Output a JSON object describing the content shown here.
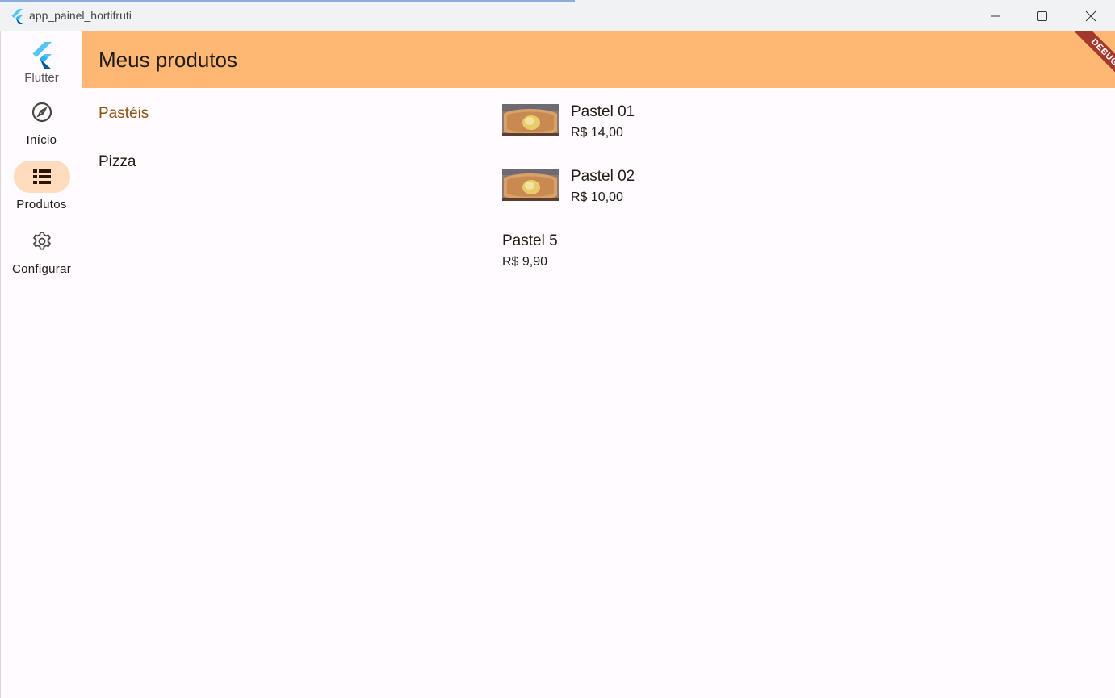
{
  "window": {
    "title": "app_painel_hortifruti"
  },
  "rail": {
    "logo_label": "Flutter",
    "items": [
      {
        "label": "Início",
        "icon": "compass-icon",
        "active": false
      },
      {
        "label": "Produtos",
        "icon": "list-icon",
        "active": true
      },
      {
        "label": "Configurar",
        "icon": "gear-icon",
        "active": false
      }
    ]
  },
  "appbar": {
    "title": "Meus produtos",
    "debug_label": "DEBUG"
  },
  "categories": [
    {
      "label": "Pastéis",
      "selected": true
    },
    {
      "label": "Pizza",
      "selected": false
    }
  ],
  "products": [
    {
      "name": "Pastel 01",
      "price": "R$ 14,00",
      "has_image": true
    },
    {
      "name": "Pastel 02",
      "price": "R$ 10,00",
      "has_image": true
    },
    {
      "name": "Pastel 5",
      "price": "R$ 9,90",
      "has_image": false
    }
  ],
  "colors": {
    "appbar": "#ffb874",
    "selected_category": "#8b5012",
    "rail_active_pill": "#ffdcbd",
    "debug_ribbon": "#a5382c"
  }
}
